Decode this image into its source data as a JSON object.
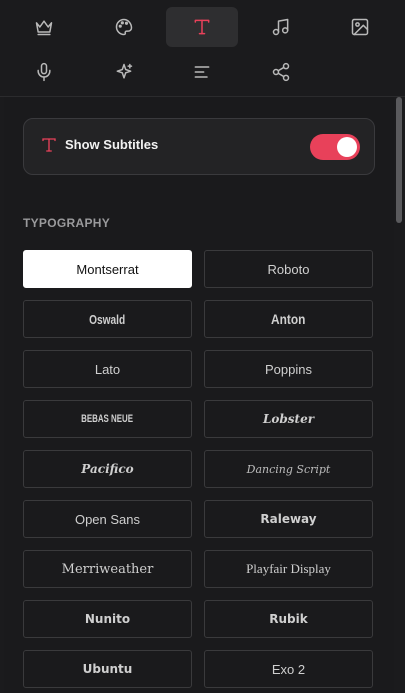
{
  "toolbar": {
    "icons": [
      "crown-icon",
      "palette-icon",
      "text-icon",
      "music-icon",
      "image-icon",
      "microphone-icon",
      "sparkles-icon",
      "align-left-icon",
      "share-icon"
    ],
    "active": "text-icon",
    "accent_color": "#e8415a"
  },
  "subtitles": {
    "label": "Show Subtitles",
    "enabled": true
  },
  "typography": {
    "title": "TYPOGRAPHY",
    "fonts": [
      "Montserrat",
      "Roboto",
      "Oswald",
      "Anton",
      "Lato",
      "Poppins",
      "BEBAS NEUE",
      "Lobster",
      "Pacifico",
      "Dancing Script",
      "Open Sans",
      "Raleway",
      "Merriweather",
      "Playfair Display",
      "Nunito",
      "Rubik",
      "Ubuntu",
      "Exo 2"
    ],
    "selected": "Montserrat"
  }
}
